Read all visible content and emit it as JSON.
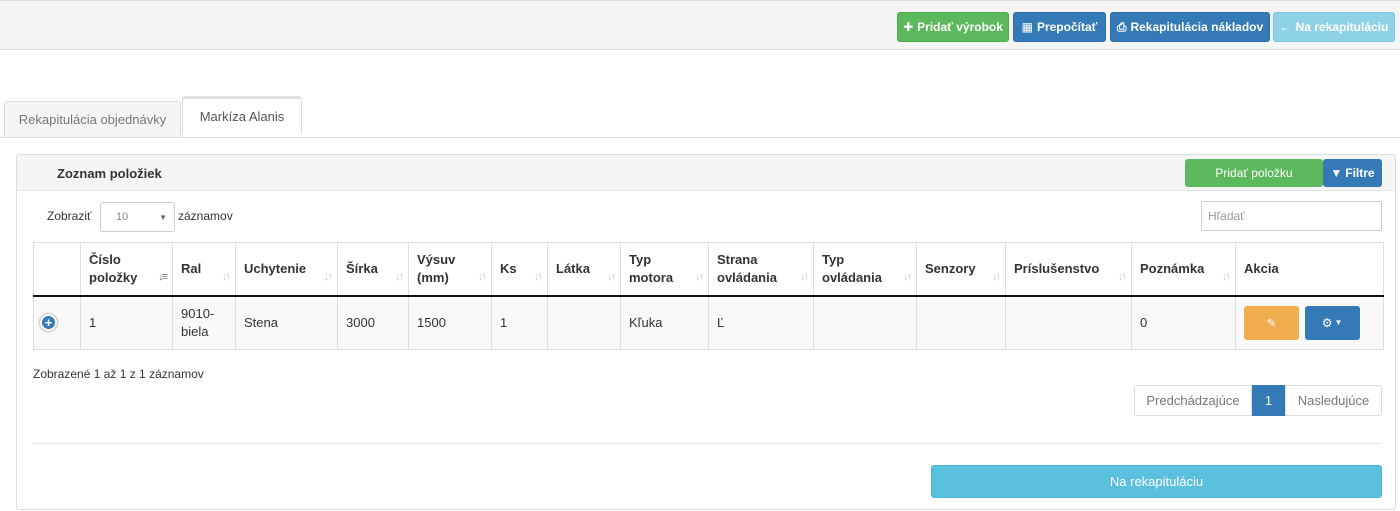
{
  "toolbar": {
    "add_product": "Pridať výrobok",
    "recalculate": "Prepočítať",
    "cost_summary": "Rekapitulácia nákladov",
    "to_summary": "Na rekapituláciu"
  },
  "tabs": [
    {
      "label": "Rekapitulácia objednávky",
      "active": false
    },
    {
      "label": "Markíza Alanis",
      "active": true
    }
  ],
  "panel": {
    "title": "Zoznam položiek",
    "add_item": "Pridať položku",
    "filters": "Filtre"
  },
  "length": {
    "label_before": "Zobraziť",
    "value": "10",
    "label_after": "záznamov"
  },
  "search": {
    "placeholder": "Hľadať"
  },
  "table": {
    "columns": [
      "",
      "Číslo položky",
      "Ral",
      "Uchytenie",
      "Šírka",
      "Výsuv (mm)",
      "Ks",
      "Látka",
      "Typ motora",
      "Strana ovládania",
      "Typ ovládania",
      "Senzory",
      "Príslušenstvo",
      "Poznámka",
      "Akcia"
    ],
    "rows": [
      [
        "",
        "1",
        "9010-biela",
        "Stena",
        "3000",
        "1500",
        "1",
        "",
        "Kľuka",
        "Ľ",
        "",
        "",
        "",
        "0",
        ""
      ]
    ]
  },
  "info": "Zobrazené 1 až 1 z 1 záznamov",
  "pager": {
    "prev": "Predchádzajúce",
    "current": "1",
    "next": "Nasledujúce"
  },
  "bottom_button": "Na rekapituláciu",
  "colors": {
    "green": "#5cb85c",
    "blue": "#337ab7",
    "info": "#5bc0de",
    "orange": "#f0ad4e"
  }
}
